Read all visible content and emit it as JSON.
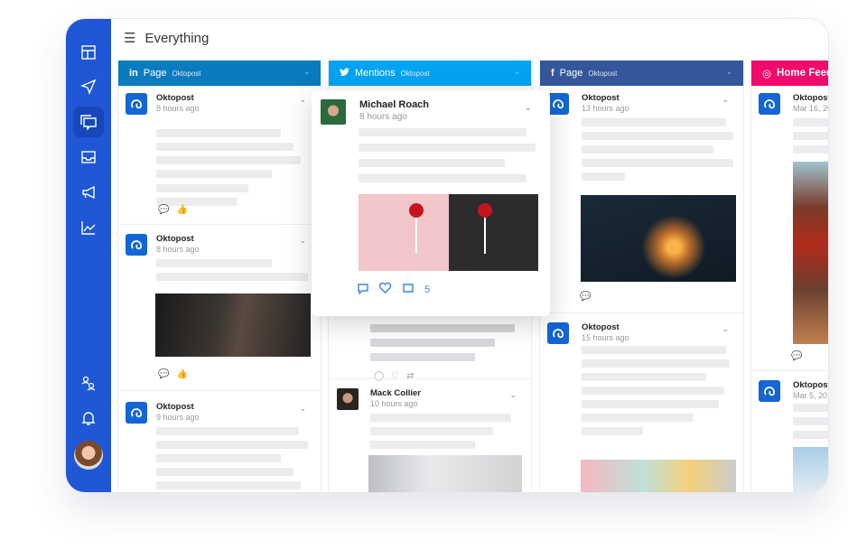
{
  "header": {
    "title": "Everything"
  },
  "sidebar": {
    "items": [
      "dashboard-icon",
      "send-icon",
      "conversations-icon",
      "inbox-icon",
      "megaphone-icon",
      "analytics-icon",
      "switch-user-icon",
      "bell-icon"
    ],
    "active": "conversations-icon"
  },
  "columns": [
    {
      "network": "linkedin",
      "icon": "in",
      "label": "Page",
      "sub": "Oktopost",
      "color": "#0a7bbf",
      "posts": [
        {
          "name": "Oktopost",
          "time": "8 hours ago"
        },
        {
          "name": "Oktopost",
          "time": "8 hours ago"
        },
        {
          "name": "Oktopost",
          "time": "9 hours ago"
        }
      ]
    },
    {
      "network": "twitter",
      "icon": "🐦",
      "label": "Mentions",
      "sub": "Oktopost",
      "color": "#03a3f2",
      "posts": [
        {
          "name": "Mack Collier",
          "time": "10 hours ago"
        }
      ]
    },
    {
      "network": "facebook",
      "icon": "f",
      "label": "Page",
      "sub": "Oktopost",
      "color": "#34569b",
      "posts": [
        {
          "name": "Oktopost",
          "time": "13 hours ago"
        },
        {
          "name": "Oktopost",
          "time": "15 hours ago"
        }
      ]
    },
    {
      "network": "instagram",
      "icon": "◎",
      "label": "Home Feed",
      "sub": "",
      "color": "#f00a6b",
      "posts": [
        {
          "name": "Oktopost",
          "time": "Mar 16, 20"
        },
        {
          "name": "Oktopost",
          "time": "Mar 5, 20"
        }
      ]
    }
  ],
  "popup": {
    "name": "Michael Roach",
    "time": "8 hours ago",
    "retweets": "5",
    "accent": "#3b82e6"
  }
}
